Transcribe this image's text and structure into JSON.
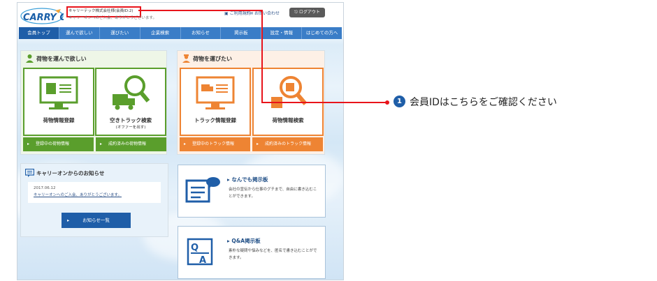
{
  "header": {
    "logo_text": "CARRY ON!",
    "account_name": "キャリーテック株式会社様(会員ID:2)",
    "welcome": "キャリーオンへのご入会、ありがとうございます。",
    "link_mypage": "ご利用規約",
    "link_contact": "お問い合わせ",
    "logout_label": "ログアウト"
  },
  "nav": {
    "items": [
      "会員トップ",
      "運んで欲しい",
      "運びたい",
      "企業検索",
      "お知らせ",
      "掲示板",
      "設定・情報",
      "はじめての方へ"
    ]
  },
  "shipper_panel": {
    "title": "荷物を運んで欲しい",
    "card1_label": "荷物情報登録",
    "card2_label": "空きトラック検索",
    "card2_sub": "(オファーを出す)",
    "btn1": "登録中の荷物情報",
    "btn2": "成約済みの荷物情報"
  },
  "carrier_panel": {
    "title": "荷物を運びたい",
    "card1_label": "トラック情報登録",
    "card2_label": "荷物情報検索",
    "btn1": "登録中のトラック情報",
    "btn2": "成約済みのトラック情報"
  },
  "news": {
    "title": "キャリーオンからのお知らせ",
    "date": "2017.06.12",
    "headline": "キャリーオンへのご入会、ありがとうございます。",
    "list_button": "お知らせ一覧"
  },
  "boards": {
    "general_title": "なんでも掲示板",
    "general_desc": "会社の宣伝から仕事のグチまで、自由に書き込むことができます。",
    "qa_title": "Q&A掲示板",
    "qa_desc": "素朴な疑問や悩みなどを、匿名で書き込むことができます。"
  },
  "callout": {
    "number": "1",
    "text": "会員IDはこちらをご確認ください"
  },
  "colors": {
    "nav_blue": "#3a7dc7",
    "green": "#5a9e2c",
    "orange": "#ee8433",
    "callout_red": "#e8141b"
  }
}
